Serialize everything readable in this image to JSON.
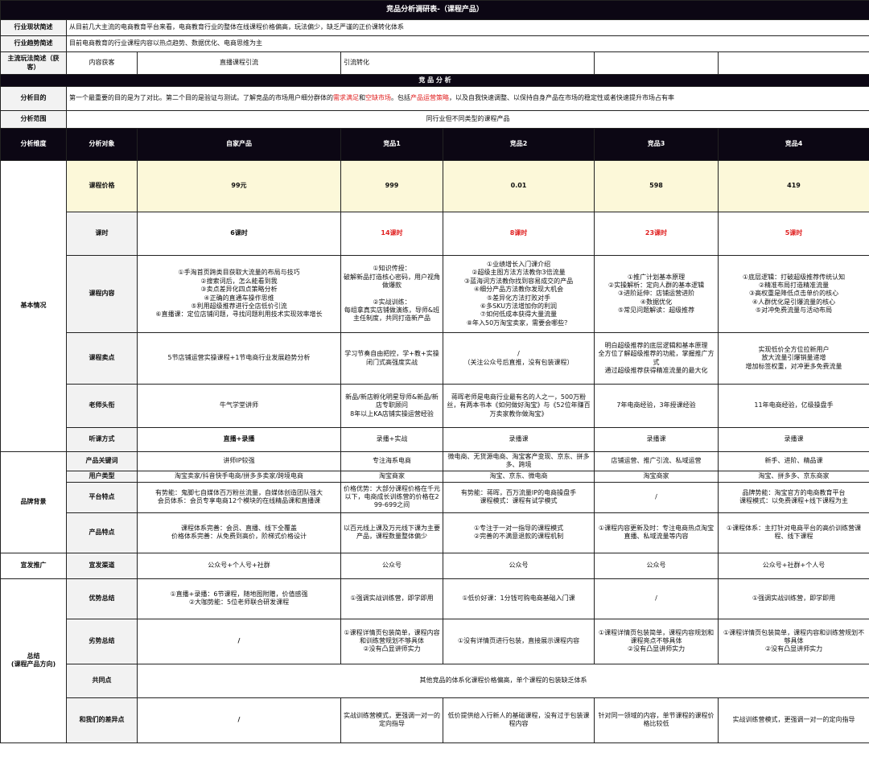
{
  "title": "竞品分析调研表-（课程产品）",
  "industry_status": {
    "label": "行业现状简述",
    "text": "从目前几大主流的电商教育平台来看，电商教育行业的整体在线课程价格偏高，玩法偏少，缺乏严谨的正价课转化体系"
  },
  "industry_trend": {
    "label": "行业趋势简述",
    "text": "目前电商教育的行业课程内容以热点趋势、数据优化、电商思维为主"
  },
  "play_method": {
    "label": "主流玩法简述（获客）",
    "cells": [
      "内容获客",
      "直播课程引流",
      "引流转化"
    ]
  },
  "section_title": "竞 品 分 析",
  "purpose": {
    "label": "分析目的",
    "t1": "第一个最重要的目的是为了对比。第二个目的是验证与测试。了解竞品的市场用户细分群体的",
    "h1": "需求满足",
    "t2": "和",
    "h2": "空缺市场",
    "t3": "。包括",
    "h3": "产品运营策略",
    "t4": "，以及自我快速调整、以保持自身产品在市场的稳定性或者快速提升市场占有率"
  },
  "scope": {
    "label": "分析范围",
    "text": "同行业但不同类型的课程产品"
  },
  "header": {
    "dimension": "分析维度",
    "object": "分析对象",
    "cols": [
      "自家产品",
      "竞品1",
      "竞品2",
      "竞品3",
      "竞品4"
    ]
  },
  "groups": {
    "basic": "基本情况",
    "brand": "品牌背景",
    "promo": "宣发推广",
    "summary": "总结\n(课程产品方向)"
  },
  "rows": {
    "price": {
      "label": "课程价格",
      "values": [
        "99元",
        "999",
        "0.01",
        "598",
        "419"
      ]
    },
    "hours": {
      "label": "课时",
      "values": [
        "6课时",
        "14课时",
        "8课时",
        "23课时",
        "5课时"
      ]
    },
    "content": {
      "label": "课程内容",
      "values": [
        "①手淘首页跨类目获取大流量的布局与技巧\n②搜索词后，怎么能看到我\n③卖点差异化四点策略分析\n④正确的直通车操作思维\n⑤利用超级推荐进行全店低价引流\n⑥直播课：定位店铺问题，寻找问题利用技术实现效率增长",
        "①知识传授：\n破解新品打造核心密码，用户视角做爆款\n\n②实战训练：\n每组拿真实店铺做演练，导师&班主任制度，共同打造新产品",
        "①业绩增长入门课介绍\n②超级主图方法方法教你3倍流量\n③蓝海词方法教你找到容易成交的产品\n④细分产品方法教你发现大机会\n⑤差异化方法打败对手\n⑥多SKU方法增加你的利润\n⑦如何低成本获得大量流量\n⑧年入50万淘宝卖家，需要会哪些？",
        "①推广计划基本原理\n②实操解析：定向人群的基本逻辑\n③进阶延伸：店铺运营进阶\n④数据优化\n⑤常见问题解读：超级推荐",
        "①底层逻辑：打破超级推荐传统认知\n②精准布局打造精准流量\n③高权重是降低点击单价的核心\n④人群优化是引爆流量的核心\n⑤对冲免费流量与活动布局"
      ]
    },
    "selling": {
      "label": "课程卖点",
      "values": [
        "5节店铺运营实操课程+1节电商行业发展趋势分析",
        "学习节奏自由把控，学+教+实操闭门式高强度实战",
        "/\n（关注公众号后直推，没有包装课程）",
        "明白超级推荐的底层逻辑和基本原理\n全方位了解超级推荐的功能，掌握推广方式\n通过超级推荐获得精准流量的最大化",
        "实现低价全方位拉新用户\n放大流量引爆销量递增\n增加标签权重，对冲更多免费流量"
      ]
    },
    "teacher": {
      "label": "老师头衔",
      "values": [
        "牛气学堂讲师",
        "新品/新店孵化明星导师&新品/新店专职顾问\n8年以上KA店铺实操运营经验",
        "蒋晖老师是电商行业最有名的人之一，500万粉丝，有两本书本《如何做好淘宝》与《52位年赚百万卖家教你做淘宝》",
        "7年电商经验，3年授课经验",
        "11年电商经验，亿级操盘手"
      ]
    },
    "listen": {
      "label": "听课方式",
      "values": [
        "直播+录播",
        "录播+实战",
        "录播课",
        "录播课",
        "录播课"
      ]
    },
    "keyword": {
      "label": "产品关键词",
      "values": [
        "讲师IP较强",
        "专注海系电商",
        "微电商、无货源电商、淘宝客产变现、京东、拼多多、跨境",
        "店铺运营、推广引流、私域运营",
        "新手、进阶、精品课"
      ]
    },
    "usertype": {
      "label": "用户类型",
      "values": [
        "淘宝卖家/抖音快手电商/拼多多卖家/跨境电商",
        "淘宝商家",
        "淘宝、京东、微电商",
        "淘宝商家",
        "淘宝、拼多多、京东商家"
      ]
    },
    "platform": {
      "label": "平台特点",
      "values": [
        "有势能：鬼脚七自媒体百万粉丝流量，自媒体创造团队强大\n会员体系：会员专享电商12个模块的在线精品课和直播课",
        "价格优势：大部分课程价格在千元以下，电商成长训练营的价格在299-699之间",
        "有势能：蒋晖，百万流量IP的电商操盘手\n课程模式：课程有试学模式",
        "/",
        "品牌势能：淘宝官方的电商教育平台\n课程模式：以免费课程+线下课程为主"
      ]
    },
    "product": {
      "label": "产品特点",
      "values": [
        "课程体系完善：会员、直播、线下全覆盖\n价格体系完善：从免费到高价，阶梯式价格设计",
        "以百元线上课及万元线下课为主要产品，课程数量整体偏少",
        "①专注于一对一指导的课程模式\n②完善的不满意退款的课程机制",
        "①课程内容更新及时：专注电商热点淘宝直播、私域流量等内容",
        "①课程体系：主打针对电商平台的高价训练营课程、线下课程"
      ]
    },
    "channel": {
      "label": "宣发渠道",
      "values": [
        "公众号+个人号+社群",
        "公众号",
        "公众号",
        "公众号",
        "公众号+社群+个人号"
      ]
    },
    "advantage": {
      "label": "优势总结",
      "values": [
        "①直播+录播：6节课程，随地图附赠，价值感强\n②大咖势能：5位老师联合研发课程",
        "①强调实战训练营，即学即用",
        "①低价好课：1分钱可购电商基础入门课",
        "/",
        "①强调实战训练营，即学即用"
      ]
    },
    "disadvantage": {
      "label": "劣势总结",
      "values": [
        "/",
        "①课程详情页包装简单，课程内容和训练营规划不够具体\n②没有凸显讲师实力",
        "①没有详情页进行包装，直接展示课程内容",
        "①课程详情页包装简单，课程内容规划和课程亮点不够具体\n②没有凸显讲师实力",
        "①课程详情页包装简单，课程内容和训练营规划不够具体\n②没有凸显讲师实力"
      ]
    },
    "common": {
      "label": "共同点",
      "text": "其他竞品的体系化课程价格偏高，单个课程的包装缺乏体系"
    },
    "diff": {
      "label": "和我们的差异点",
      "values": [
        "/",
        "实战训练营模式，更强调一对一的定向指导",
        "低价提供给入行新人的基础课程，没有过于包装课程内容",
        "针对同一领域的内容，单节课程的课程价格比较低",
        "实战训练营模式，更强调一对一的定向指导"
      ]
    }
  }
}
